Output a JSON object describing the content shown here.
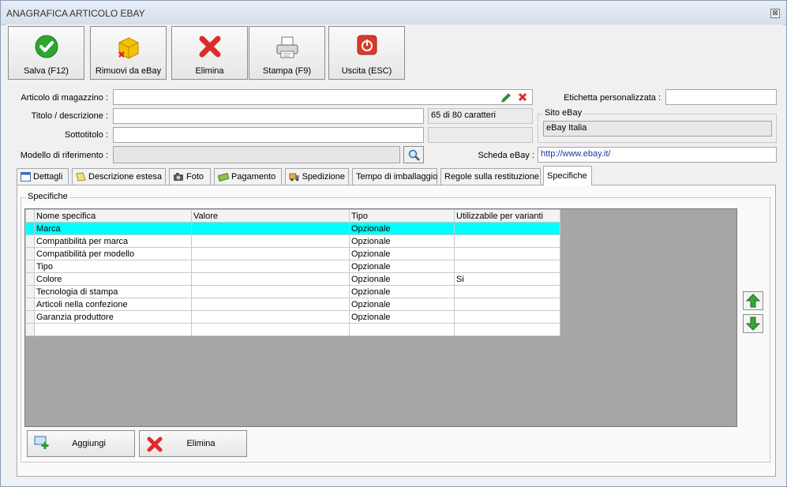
{
  "window": {
    "title": "ANAGRAFICA ARTICOLO EBAY",
    "close_glyph": "⊠"
  },
  "toolbar": [
    {
      "id": "save",
      "label": "Salva (F12)",
      "icon": "check-circle-icon"
    },
    {
      "id": "remove",
      "label": "Rimuovi da eBay",
      "icon": "box-remove-icon"
    },
    {
      "id": "delete",
      "label": "Elimina",
      "icon": "red-x-icon"
    },
    {
      "id": "print",
      "label": "Stampa (F9)",
      "icon": "printer-icon"
    },
    {
      "id": "exit",
      "label": "Uscita (ESC)",
      "icon": "power-icon"
    }
  ],
  "form": {
    "articolo_label": "Articolo di magazzino :",
    "articolo_value": "",
    "titolo_label": "Titolo / descrizione :",
    "titolo_value": "",
    "char_count": "65 di 80 caratteri",
    "sottotitolo_label": "Sottotitolo :",
    "sottotitolo_value": "",
    "modello_label": "Modello di riferimento :",
    "modello_value": "",
    "etichetta_label": "Etichetta personalizzata :",
    "etichetta_value": "",
    "sito_group": "Sito eBay",
    "sito_value": "eBay Italia",
    "scheda_label": "Scheda eBay :",
    "scheda_value": "http://www.ebay.it/"
  },
  "tabs": [
    {
      "label": "Dettagli",
      "icon": "details-icon"
    },
    {
      "label": "Descrizione estesa",
      "icon": "note-icon"
    },
    {
      "label": "Foto",
      "icon": "camera-icon"
    },
    {
      "label": "Pagamento",
      "icon": "money-icon"
    },
    {
      "label": "Spedizione",
      "icon": "shipping-icon"
    },
    {
      "label": "Tempo di imballaggio",
      "icon": ""
    },
    {
      "label": "Regole sulla restituzione",
      "icon": ""
    },
    {
      "label": "Specifiche",
      "icon": ""
    }
  ],
  "active_tab": "Specifiche",
  "specifiche": {
    "group_title": "Specifiche",
    "columns": [
      "Nome specifica",
      "Valore",
      "Tipo",
      "Utilizzabile per varianti"
    ],
    "rows": [
      [
        "Marca",
        "",
        "Opzionale",
        ""
      ],
      [
        "Compatibilità per marca",
        "",
        "Opzionale",
        ""
      ],
      [
        "Compatibilità per modello",
        "",
        "Opzionale",
        ""
      ],
      [
        "Tipo",
        "",
        "Opzionale",
        ""
      ],
      [
        "Colore",
        "",
        "Opzionale",
        "Si"
      ],
      [
        "Tecnologia di stampa",
        "",
        "Opzionale",
        ""
      ],
      [
        "Articoli nella confezione",
        "",
        "Opzionale",
        ""
      ],
      [
        "Garanzia produttore",
        "",
        "Opzionale",
        ""
      ],
      [
        "",
        "",
        "",
        ""
      ]
    ],
    "selected_row": 0,
    "add_label": "Aggiungi",
    "delete_label": "Elimina"
  },
  "colors": {
    "selection": "#00ffff",
    "grid_bg": "#a6a6a6",
    "arrow_green": "#3aa53a"
  }
}
